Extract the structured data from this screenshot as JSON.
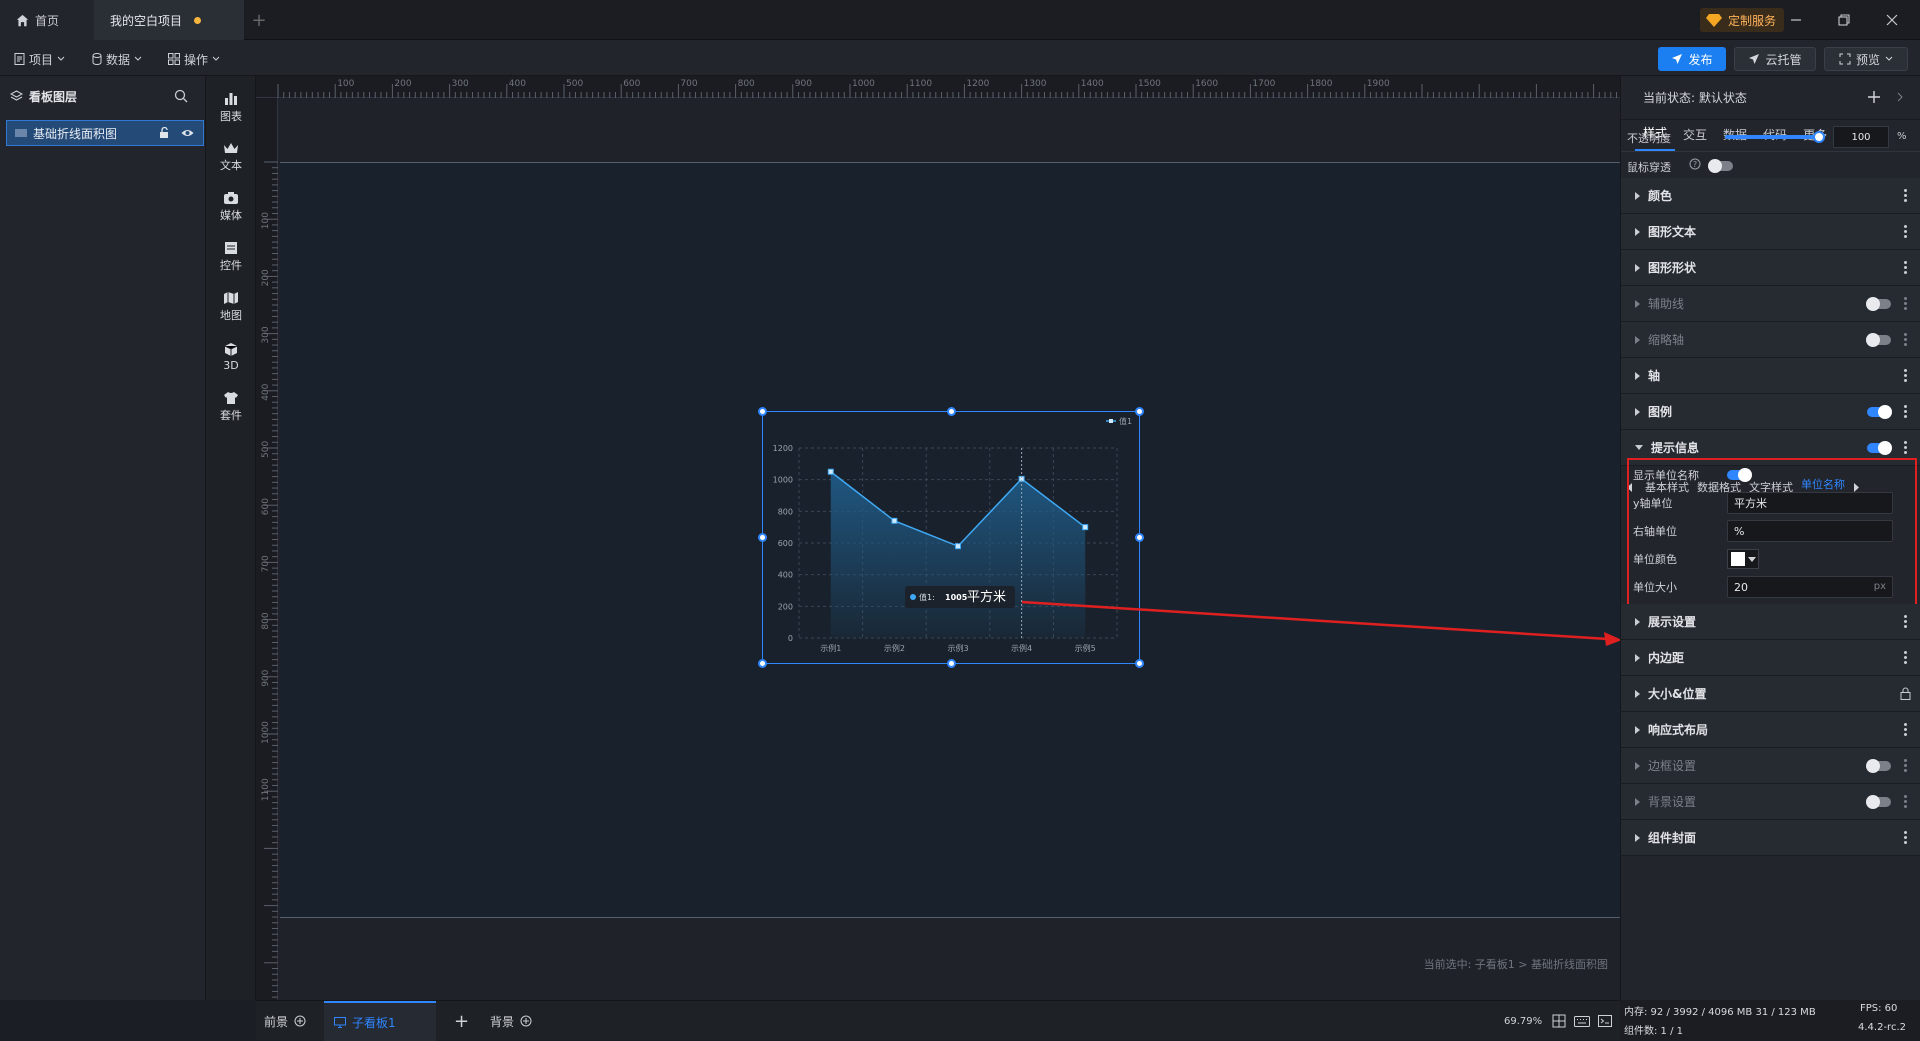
{
  "titlebar": {
    "home_tab": "首页",
    "project_tab": "我的空白项目",
    "custom_service": "定制服务"
  },
  "toolbar": {
    "menus": [
      "项目",
      "数据",
      "操作"
    ],
    "publish": "发布",
    "cloud": "云托管",
    "preview": "预览"
  },
  "layers": {
    "title": "看板图层",
    "item": "基础折线面积图"
  },
  "components": [
    "图表",
    "文本",
    "媒体",
    "控件",
    "地图",
    "3D",
    "套件"
  ],
  "ruler": {
    "h": [
      "100",
      "200",
      "300",
      "400",
      "500",
      "600",
      "700",
      "800",
      "900",
      "1000",
      "1100",
      "1200",
      "1300",
      "1400",
      "1500",
      "1600",
      "1700",
      "1800",
      "1900"
    ],
    "v": [
      "100",
      "200",
      "300",
      "400",
      "500",
      "600",
      "700",
      "800",
      "900",
      "1000",
      "1100"
    ]
  },
  "chart_data": {
    "type": "area",
    "categories": [
      "示例1",
      "示例2",
      "示例3",
      "示例4",
      "示例5"
    ],
    "series": [
      {
        "name": "值1",
        "values": [
          1050,
          740,
          580,
          1005,
          700
        ]
      }
    ],
    "ylim": [
      0,
      1200
    ],
    "yticks": [
      "0",
      "200",
      "400",
      "600",
      "800",
      "1000",
      "1200"
    ],
    "legend": "top-right",
    "grid": true,
    "tooltip": {
      "series": "值1:",
      "value": "1005",
      "unit": "平方米"
    },
    "colors": {
      "line": "#3fa9f5",
      "area": "#1f5a86"
    }
  },
  "canvas": {
    "status_path": "当前选中: 子看板1 > 基础折线面积图"
  },
  "bottombar": {
    "foreground": "前景",
    "sub_board": "子看板1",
    "background": "背景",
    "zoom": "69.79%"
  },
  "panel": {
    "current_state": "当前状态:  默认状态",
    "tabs": [
      "样式",
      "交互",
      "数据",
      "代码",
      "更多"
    ],
    "opacity_label": "不透明度",
    "opacity_value": "100",
    "opacity_unit": "%",
    "mouse_through": "鼠标穿透",
    "sections_top": [
      "颜色",
      "图形文本",
      "图形形状",
      "辅助线",
      "缩略轴",
      "轴",
      "图例",
      "提示信息"
    ],
    "subtabs": [
      "基本样式",
      "数据格式",
      "文字样式",
      "单位名称"
    ],
    "unit_fields": {
      "show_unit": "显示单位名称",
      "y_unit_label": "y轴单位",
      "y_unit_value": "平方米",
      "right_unit_label": "右轴单位",
      "right_unit_value": "%",
      "unit_color_label": "单位颜色",
      "unit_size_label": "单位大小",
      "unit_size_value": "20",
      "unit_size_suffix": "px"
    },
    "sections_bottom": [
      "展示设置",
      "内边距",
      "大小&位置",
      "响应式布局",
      "边框设置",
      "背景设置",
      "组件封面"
    ]
  },
  "footer": {
    "memory": "内存:  92 / 3992 / 4096 MB  31 / 123 MB",
    "fps": "FPS:  60",
    "components": "组件数: 1 / 1",
    "version": "4.4.2-rc.2"
  }
}
